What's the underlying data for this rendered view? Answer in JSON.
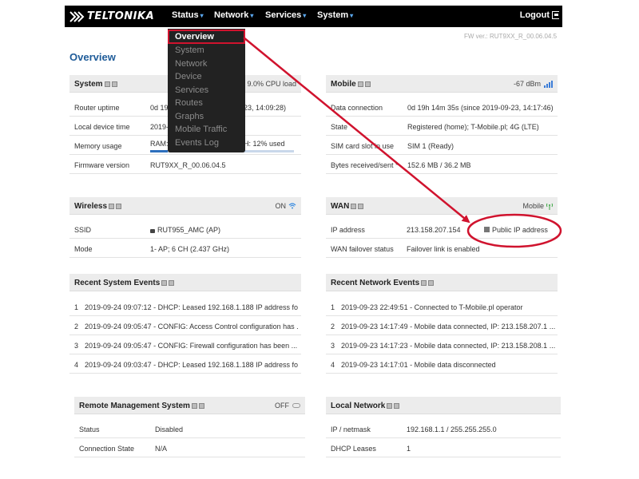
{
  "brand": {
    "logo_text": "TELTONIKA"
  },
  "nav": {
    "items": [
      {
        "label": "Status"
      },
      {
        "label": "Network"
      },
      {
        "label": "Services"
      },
      {
        "label": "System"
      }
    ],
    "logout_label": "Logout"
  },
  "dropdown": {
    "items": [
      {
        "label": "Overview"
      },
      {
        "label": "System"
      },
      {
        "label": "Network"
      },
      {
        "label": "Device"
      },
      {
        "label": "Services"
      },
      {
        "label": "Routes"
      },
      {
        "label": "Graphs"
      },
      {
        "label": "Mobile Traffic"
      },
      {
        "label": "Events Log"
      }
    ]
  },
  "firmware_label": "FW ver.: RUT9XX_R_00.06.04.5",
  "page_title": "Overview",
  "system": {
    "title": "System",
    "cpu_text": "9.0% CPU load",
    "rows": [
      {
        "key": "Router uptime",
        "value": "0d 19h",
        "value2": "23, 14:09:28)"
      },
      {
        "key": "Local device time",
        "value": "2019-"
      },
      {
        "key": "Memory usage",
        "value": "RAM:",
        "value2": "H: 12% used"
      },
      {
        "key": "Firmware version",
        "value": "RUT9XX_R_00.06.04.5"
      }
    ],
    "ram_used_fraction": 0.12
  },
  "mobile": {
    "title": "Mobile",
    "signal": "-67 dBm",
    "rows": [
      {
        "key": "Data connection",
        "value": "0d 19h 14m 35s (since 2019-09-23, 14:17:46)"
      },
      {
        "key": "State",
        "value": "Registered (home); T-Mobile.pl; 4G (LTE)"
      },
      {
        "key": "SIM card slot in use",
        "value": "SIM 1 (Ready)"
      },
      {
        "key": "Bytes received/sent *",
        "value": "152.6 MB / 36.2 MB"
      }
    ]
  },
  "wireless": {
    "title": "Wireless",
    "status": "ON",
    "rows": [
      {
        "key": "SSID",
        "value": "RUT955_AMC (AP)"
      },
      {
        "key": "Mode",
        "value": "1- AP; 6 CH (2.437 GHz)"
      }
    ]
  },
  "wan": {
    "title": "WAN",
    "type": "Mobile",
    "rows": [
      {
        "key": "IP address",
        "value": "213.158.207.154",
        "link": "Public IP address"
      },
      {
        "key": "WAN failover status",
        "value": "Failover link is enabled"
      }
    ]
  },
  "system_events": {
    "title": "Recent System Events",
    "rows": [
      {
        "num": "1",
        "text": "2019-09-24 09:07:12 - DHCP: Leased 192.168.1.188 IP address fo ..."
      },
      {
        "num": "2",
        "text": "2019-09-24 09:05:47 - CONFIG: Access Control configuration has ..."
      },
      {
        "num": "3",
        "text": "2019-09-24 09:05:47 - CONFIG: Firewall configuration has been ..."
      },
      {
        "num": "4",
        "text": "2019-09-24 09:03:47 - DHCP: Leased 192.168.1.188 IP address fo ..."
      }
    ]
  },
  "network_events": {
    "title": "Recent Network Events",
    "rows": [
      {
        "num": "1",
        "text": "2019-09-23 22:49:51 - Connected to T-Mobile.pl operator"
      },
      {
        "num": "2",
        "text": "2019-09-23 14:17:49 - Mobile data connected, IP: 213.158.207.1 ..."
      },
      {
        "num": "3",
        "text": "2019-09-23 14:17:23 - Mobile data connected, IP: 213.158.208.1 ..."
      },
      {
        "num": "4",
        "text": "2019-09-23 14:17:01 - Mobile data disconnected"
      }
    ]
  },
  "rms": {
    "title": "Remote Management System",
    "status": "OFF",
    "rows": [
      {
        "key": "Status",
        "value": "Disabled"
      },
      {
        "key": "Connection State",
        "value": "N/A"
      }
    ]
  },
  "local_network": {
    "title": "Local Network",
    "rows": [
      {
        "key": "IP / netmask",
        "value": "192.168.1.1 / 255.255.255.0"
      },
      {
        "key": "DHCP Leases",
        "value": "1"
      }
    ]
  },
  "colors": {
    "accent": "#1f5c99",
    "annotation": "#d0132e",
    "navbar": "#000000"
  }
}
